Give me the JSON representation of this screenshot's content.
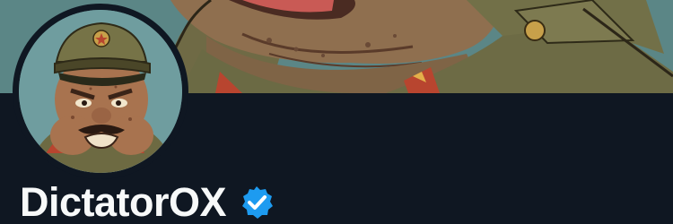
{
  "profile": {
    "display_name": "DictatorOX",
    "verified_badge_icon": "verified-badge-icon",
    "accent_color": "#1d9bf0"
  },
  "colors": {
    "background": "#0f1722",
    "banner_sky": "#5a8586",
    "text": "#f7f9f9"
  }
}
